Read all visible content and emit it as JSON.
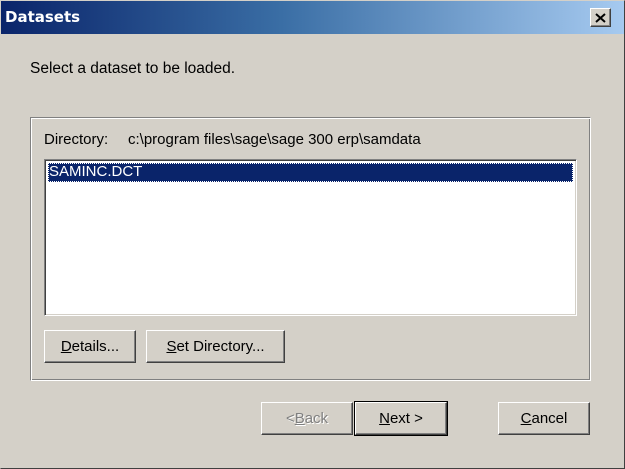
{
  "window": {
    "title": "Datasets",
    "close_icon": "close-icon"
  },
  "prompt": "Select a dataset to be loaded.",
  "directory": {
    "label": "Directory:",
    "value": "c:\\program files\\sage\\sage 300 erp\\samdata"
  },
  "datasets": {
    "items": [
      "SAMINC.DCT"
    ],
    "selected": "SAMINC.DCT"
  },
  "buttons": {
    "details": {
      "accel": "D",
      "rest": "etails..."
    },
    "set_directory": {
      "accel": "S",
      "rest": "et Directory..."
    },
    "back": {
      "prefix": "< ",
      "accel": "B",
      "rest": "ack",
      "enabled": false
    },
    "next": {
      "accel": "N",
      "rest": "ext >"
    },
    "cancel": {
      "accel": "C",
      "rest": "ancel"
    }
  },
  "colors": {
    "titlebar": "#0a246a",
    "selection": "#0a246a",
    "face": "#d4d0c8"
  }
}
